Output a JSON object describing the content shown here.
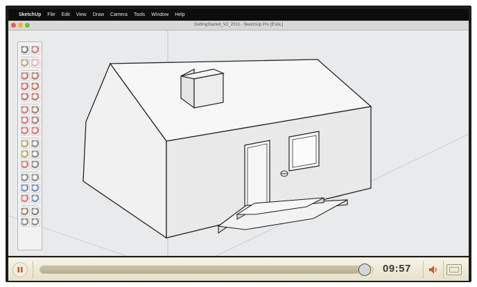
{
  "menubar": {
    "apple_glyph": "",
    "app_name": "SketchUp",
    "items": [
      "File",
      "Edit",
      "View",
      "Draw",
      "Camera",
      "Tools",
      "Window",
      "Help"
    ]
  },
  "window": {
    "title": "GettingStarted_V2_2013 - SketchUp Pro [EVAL]"
  },
  "toolbar": {
    "tools": [
      {
        "name": "select-tool-icon",
        "color": "#555555"
      },
      {
        "name": "make-component-tool-icon",
        "color": "#c0504d"
      },
      {
        "name": "paint-bucket-tool-icon",
        "color": "#a88a4a"
      },
      {
        "name": "eraser-tool-icon",
        "color": "#e39aa6"
      },
      {
        "name": "rectangle-tool-icon",
        "color": "#b24a3a"
      },
      {
        "name": "line-tool-icon",
        "color": "#b24a3a"
      },
      {
        "name": "circle-tool-icon",
        "color": "#b24a3a"
      },
      {
        "name": "arc-tool-icon",
        "color": "#b24a3a"
      },
      {
        "name": "polygon-tool-icon",
        "color": "#b24a3a"
      },
      {
        "name": "freehand-tool-icon",
        "color": "#b24a3a"
      },
      {
        "name": "move-tool-icon",
        "color": "#c0504d"
      },
      {
        "name": "push-pull-tool-icon",
        "color": "#8a5a3a"
      },
      {
        "name": "rotate-tool-icon",
        "color": "#c0504d"
      },
      {
        "name": "follow-me-tool-icon",
        "color": "#8a5a3a"
      },
      {
        "name": "scale-tool-icon",
        "color": "#c0504d"
      },
      {
        "name": "offset-tool-icon",
        "color": "#c0504d"
      },
      {
        "name": "tape-measure-tool-icon",
        "color": "#b08a3a"
      },
      {
        "name": "dimension-tool-icon",
        "color": "#666666"
      },
      {
        "name": "protractor-tool-icon",
        "color": "#b08a3a"
      },
      {
        "name": "text-tool-icon",
        "color": "#666666"
      },
      {
        "name": "axes-tool-icon",
        "color": "#c0504d"
      },
      {
        "name": "3d-text-tool-icon",
        "color": "#666666"
      },
      {
        "name": "orbit-tool-icon",
        "color": "#6a6a6a"
      },
      {
        "name": "pan-tool-icon",
        "color": "#6a6a6a"
      },
      {
        "name": "zoom-tool-icon",
        "color": "#4a6aa8"
      },
      {
        "name": "zoom-window-tool-icon",
        "color": "#4a6aa8"
      },
      {
        "name": "zoom-extents-tool-icon",
        "color": "#c0504d"
      },
      {
        "name": "previous-view-tool-icon",
        "color": "#4a6aa8"
      },
      {
        "name": "position-camera-tool-icon",
        "color": "#8a5a3a"
      },
      {
        "name": "walk-tool-icon",
        "color": "#5a5a5a"
      },
      {
        "name": "look-around-tool-icon",
        "color": "#6a6a6a"
      },
      {
        "name": "section-plane-tool-icon",
        "color": "#6a6a6a"
      }
    ]
  },
  "player": {
    "time": "09:57",
    "progress": 0.975
  },
  "colors": {
    "traffic_close": "#ee5a52",
    "traffic_min": "#e9b43a",
    "traffic_max": "#6cc04a",
    "volume_accent": "#c85a2a"
  }
}
